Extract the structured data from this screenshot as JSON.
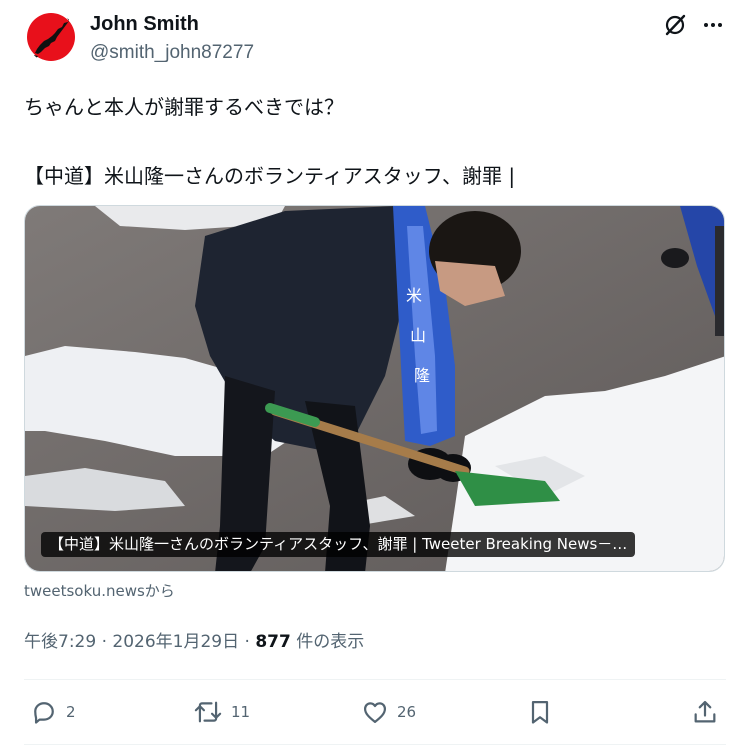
{
  "user": {
    "name": "John Smith",
    "handle": "@smith_john87277",
    "avatar": "japan-map-on-red-circle"
  },
  "header_icons": [
    "grok-icon",
    "more-icon"
  ],
  "tweet": {
    "text_line1": "ちゃんと本人が謝罪するべきでは？",
    "text_line2": "【中道】米山隆一さんのボランティアスタッフ、謝罪 |"
  },
  "card": {
    "caption": "【中道】米山隆一さんのボランティアスタッフ、謝罪 | Tweeter Breaking News－…",
    "image": "man-shoveling-snow-with-campaign-sash",
    "source": "tweetsoku.newsから"
  },
  "meta": {
    "time": "午後7:29",
    "sep1": " · ",
    "date": "2026年1月29日",
    "sep2": " · ",
    "views": "877",
    "views_label": " 件の表示"
  },
  "actions": {
    "reply_count": "2",
    "retweet_count": "11",
    "like_count": "26"
  },
  "colors": {
    "text": "#0f1419",
    "secondary": "#536471",
    "border": "#cfd9de"
  }
}
